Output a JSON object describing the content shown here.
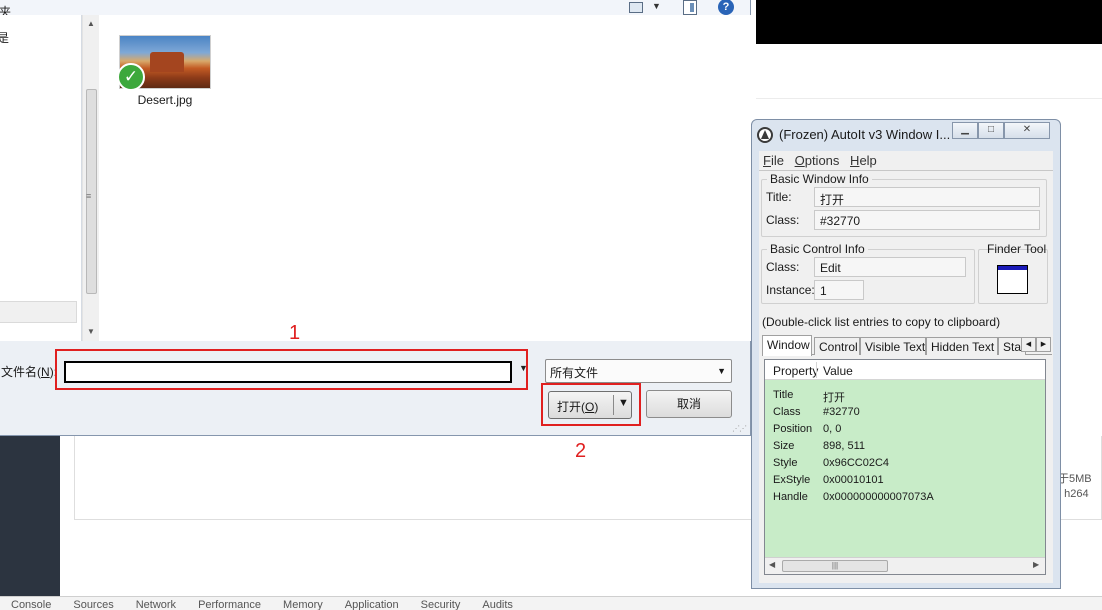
{
  "dialog": {
    "title_fragment": "夹",
    "nav_fragment": "是",
    "file": {
      "name": "Desert.jpg"
    },
    "filename_label": "文件名",
    "filename_hotkey": "N",
    "filename_value": "",
    "filetype_value": "所有文件",
    "open_label": "打开",
    "open_hotkey": "O",
    "cancel_label": "取消"
  },
  "annotations": [
    "1",
    "2"
  ],
  "background": {
    "hint_line1": "于5MB",
    "hint_line2": ": h264",
    "devtools_tabs": [
      "Console",
      "Sources",
      "Network",
      "Performance",
      "Memory",
      "Application",
      "Security",
      "Audits"
    ]
  },
  "autoit": {
    "title": "(Frozen) AutoIt v3 Window I...",
    "menu": [
      {
        "hotkey": "F",
        "rest": "ile"
      },
      {
        "hotkey": "O",
        "rest": "ptions"
      },
      {
        "hotkey": "H",
        "rest": "elp"
      }
    ],
    "basic_window_info": {
      "label": "Basic Window Info",
      "title_label": "Title:",
      "title_value": "打开",
      "class_label": "Class:",
      "class_value": "#32770"
    },
    "basic_control_info": {
      "label": "Basic Control Info",
      "class_label": "Class:",
      "class_value": "Edit",
      "instance_label": "Instance:",
      "instance_value": "1"
    },
    "finder_tool_label": "Finder Tool",
    "hint": "(Double-click list entries to copy to clipboard)",
    "tabs": [
      "Window",
      "Control",
      "Visible Text",
      "Hidden Text",
      "Stat"
    ],
    "active_tab": "Window",
    "list_headers": {
      "property": "Property",
      "value": "Value"
    },
    "properties": [
      {
        "property": "Title",
        "value": "打开"
      },
      {
        "property": "Class",
        "value": "#32770"
      },
      {
        "property": "Position",
        "value": "0, 0"
      },
      {
        "property": "Size",
        "value": "898, 511"
      },
      {
        "property": "Style",
        "value": "0x96CC02C4"
      },
      {
        "property": "ExStyle",
        "value": "0x00010101"
      },
      {
        "property": "Handle",
        "value": "0x000000000007073A"
      }
    ]
  },
  "colors": {
    "annotation_red": "#e02020",
    "list_bg": "#c8ecc8",
    "dialog_bg": "#ecf0f5"
  }
}
